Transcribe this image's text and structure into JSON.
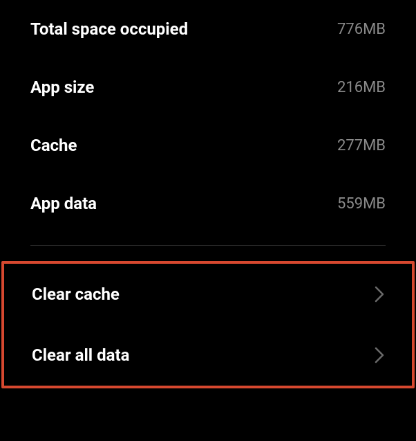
{
  "storage": {
    "rows": [
      {
        "label": "Total space occupied",
        "value": "776MB"
      },
      {
        "label": "App size",
        "value": "216MB"
      },
      {
        "label": "Cache",
        "value": "277MB"
      },
      {
        "label": "App data",
        "value": "559MB"
      }
    ]
  },
  "actions": {
    "clear_cache_label": "Clear cache",
    "clear_all_data_label": "Clear all data"
  }
}
